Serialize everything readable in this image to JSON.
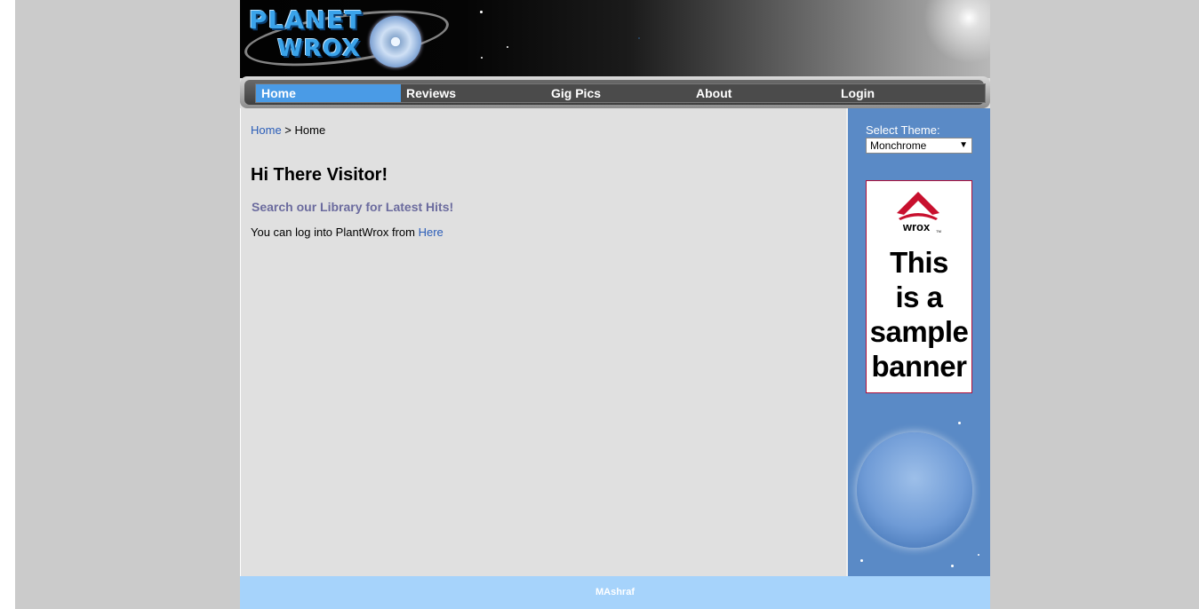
{
  "logo": {
    "line1": "PLANET",
    "line2": "WROX"
  },
  "nav": {
    "items": [
      {
        "label": "Home",
        "active": true
      },
      {
        "label": "Reviews"
      },
      {
        "label": "Gig Pics"
      },
      {
        "label": "About"
      },
      {
        "label": "Login"
      }
    ]
  },
  "breadcrumb": {
    "root": "Home",
    "separator": " > ",
    "current": "Home"
  },
  "main": {
    "heading": "Hi There Visitor!",
    "search_link": "Search our Library for Latest Hits!",
    "login_text": "You can log into PlantWrox from ",
    "login_link": "Here"
  },
  "sidebar": {
    "theme_label": "Select Theme:",
    "theme_selected": "Monchrome",
    "banner": {
      "brand": "wrox",
      "tm": "TM",
      "text_lines": [
        "This",
        "is a",
        "sample",
        "banner"
      ]
    }
  },
  "footer": {
    "text": "MAshraf"
  },
  "colors": {
    "accent": "#4a9be6",
    "sidebar": "#5a8ac6",
    "footer": "#a6d3fb",
    "banner_red": "#c8102e"
  }
}
